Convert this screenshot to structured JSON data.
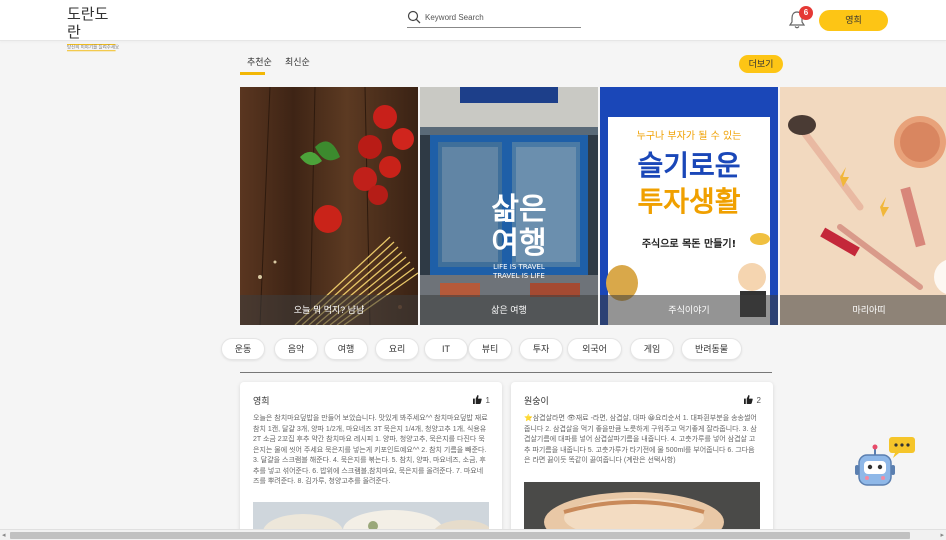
{
  "header": {
    "logo_text": "도란도란",
    "logo_sub": "당신의 이야기를 들려주세요",
    "search_placeholder": "Keyword Search",
    "notification_count": "6",
    "user_name": "영희"
  },
  "tabs": [
    {
      "label": "추천순",
      "active": true
    },
    {
      "label": "최신순",
      "active": false
    }
  ],
  "more_label": "더보기",
  "carousel": [
    {
      "caption": "오늘 뭐 먹지? 냠냠",
      "image_text": []
    },
    {
      "caption": "삶은 여행",
      "image_text": [
        "삶은",
        "여행",
        "LIFE IS TRAVEL",
        "TRAVEL IS LIFE"
      ]
    },
    {
      "caption": "주식이야기",
      "image_text": [
        "누구나 부자가 될 수 있는",
        "슬기로운",
        "투자생활",
        "주식으로 목돈 만들기!"
      ]
    },
    {
      "caption": "마리아띠",
      "image_text": []
    }
  ],
  "categories": [
    "운동",
    "음악",
    "여행",
    "요리",
    "IT",
    "뷰티",
    "투자",
    "외국어",
    "게임",
    "반려동물"
  ],
  "posts": [
    {
      "author": "영희",
      "likes": "1",
      "body": "오늘은 참치마요덮밥을 만들어 보았습니다. 맛있게 봐주세요^^ 참치마요덮밥 재료 참치 1캔, 달걀 3개, 양파 1/2개, 마요네즈 3T 묵은지 1/4개, 청양고추 1개, 식용유 2T 소금 2꼬집 후추 약간 참치마요 레시피 1. 양파, 청양고추, 묵은지를 다진다 묵은지는 물에 씻어 주세요 묵은지를 넣는게 키포인트예요^^ 2. 참치 기름을 빼준다. 3. 달걀을 스크램블 해준다. 4. 묵은지를 볶는다. 5. 참치, 양파, 마요네즈, 소금, 후추를 넣고 섞어준다. 6. 밥위에 스크램블,참치마요, 묵은지를 올려준다. 7. 마요네즈를 뿌려준다. 8. 김가루, 청양고추를 올려준다."
    },
    {
      "author": "원숭이",
      "likes": "2",
      "body": "⭐삼겹살라면 👁재료 -라면, 삼겹살, 대파 😀요리순서 1. 대파흰부분을 송송썰어줍니다 2. 삼겹살을 먹기 좋을만큼 노릇하게 구워주고 먹기좋게 잘라줍니다. 3. 삼겹살기름에 대파를 넣어 삼겹살파기름을 내줍니다. 4. 고춧가루를 넣어 삼겹살 고추 파기름을 내줍니다 5. 고춧가루가 타기전에 물 500ml를 부어줍니다 6. 그다음은 라면 끓이듯 똑같이 끓여줍니다 (계란은 선택사항)"
    }
  ],
  "colors": {
    "accent": "#fdc515",
    "badge": "#e53935"
  }
}
